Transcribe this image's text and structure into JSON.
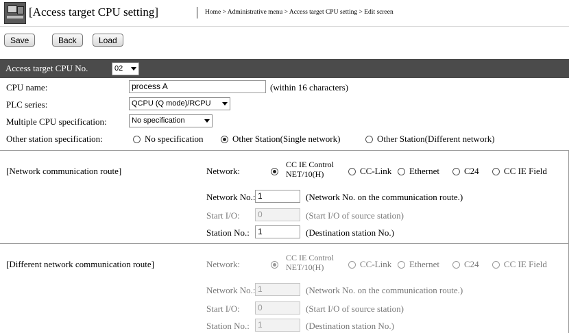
{
  "header": {
    "title": "[Access target CPU setting]",
    "breadcrumb": "Home > Administrative menu > Access target CPU setting > Edit screen"
  },
  "toolbar": {
    "save_label": "Save",
    "back_label": "Back",
    "load_label": "Load"
  },
  "access_target": {
    "label": "Access target CPU No.",
    "value": "02"
  },
  "cpu": {
    "name_label": "CPU name:",
    "name_value": "process A",
    "name_hint": "(within 16 characters)",
    "plc_label": "PLC series:",
    "plc_value": "QCPU (Q mode)/RCPU",
    "multi_label": "Multiple CPU specification:",
    "multi_value": "No specification",
    "other_label": "Other station specification:",
    "other_options": [
      "No specification",
      "Other Station(Single network)",
      "Other Station(Different network)"
    ],
    "other_selected": 1
  },
  "route1": {
    "title": "[Network communication route]",
    "network_label": "Network:",
    "network_options": [
      "CC IE Control",
      "NET/10(H)",
      "CC-Link",
      "Ethernet",
      "C24",
      "CC IE Field"
    ],
    "network_selected": 0,
    "netno_label": "Network No.:",
    "netno_value": "1",
    "netno_hint": "(Network No. on the communication route.)",
    "startio_label": "Start I/O:",
    "startio_value": "0",
    "startio_hint": "(Start I/O of source station)",
    "station_label": "Station No.:",
    "station_value": "1",
    "station_hint": "(Destination station No.)"
  },
  "route2": {
    "title": "[Different network communication route]",
    "network_label": "Network:",
    "network_options": [
      "CC IE Control",
      "NET/10(H)",
      "CC-Link",
      "Ethernet",
      "C24",
      "CC IE Field"
    ],
    "network_selected": 0,
    "netno_label": "Network No.:",
    "netno_value": "1",
    "netno_hint": "(Network No. on the communication route.)",
    "startio_label": "Start I/O:",
    "startio_value": "0",
    "startio_hint": "(Start I/O of source station)",
    "station_label": "Station No.:",
    "station_value": "1",
    "station_hint": "(Destination station No.)"
  }
}
